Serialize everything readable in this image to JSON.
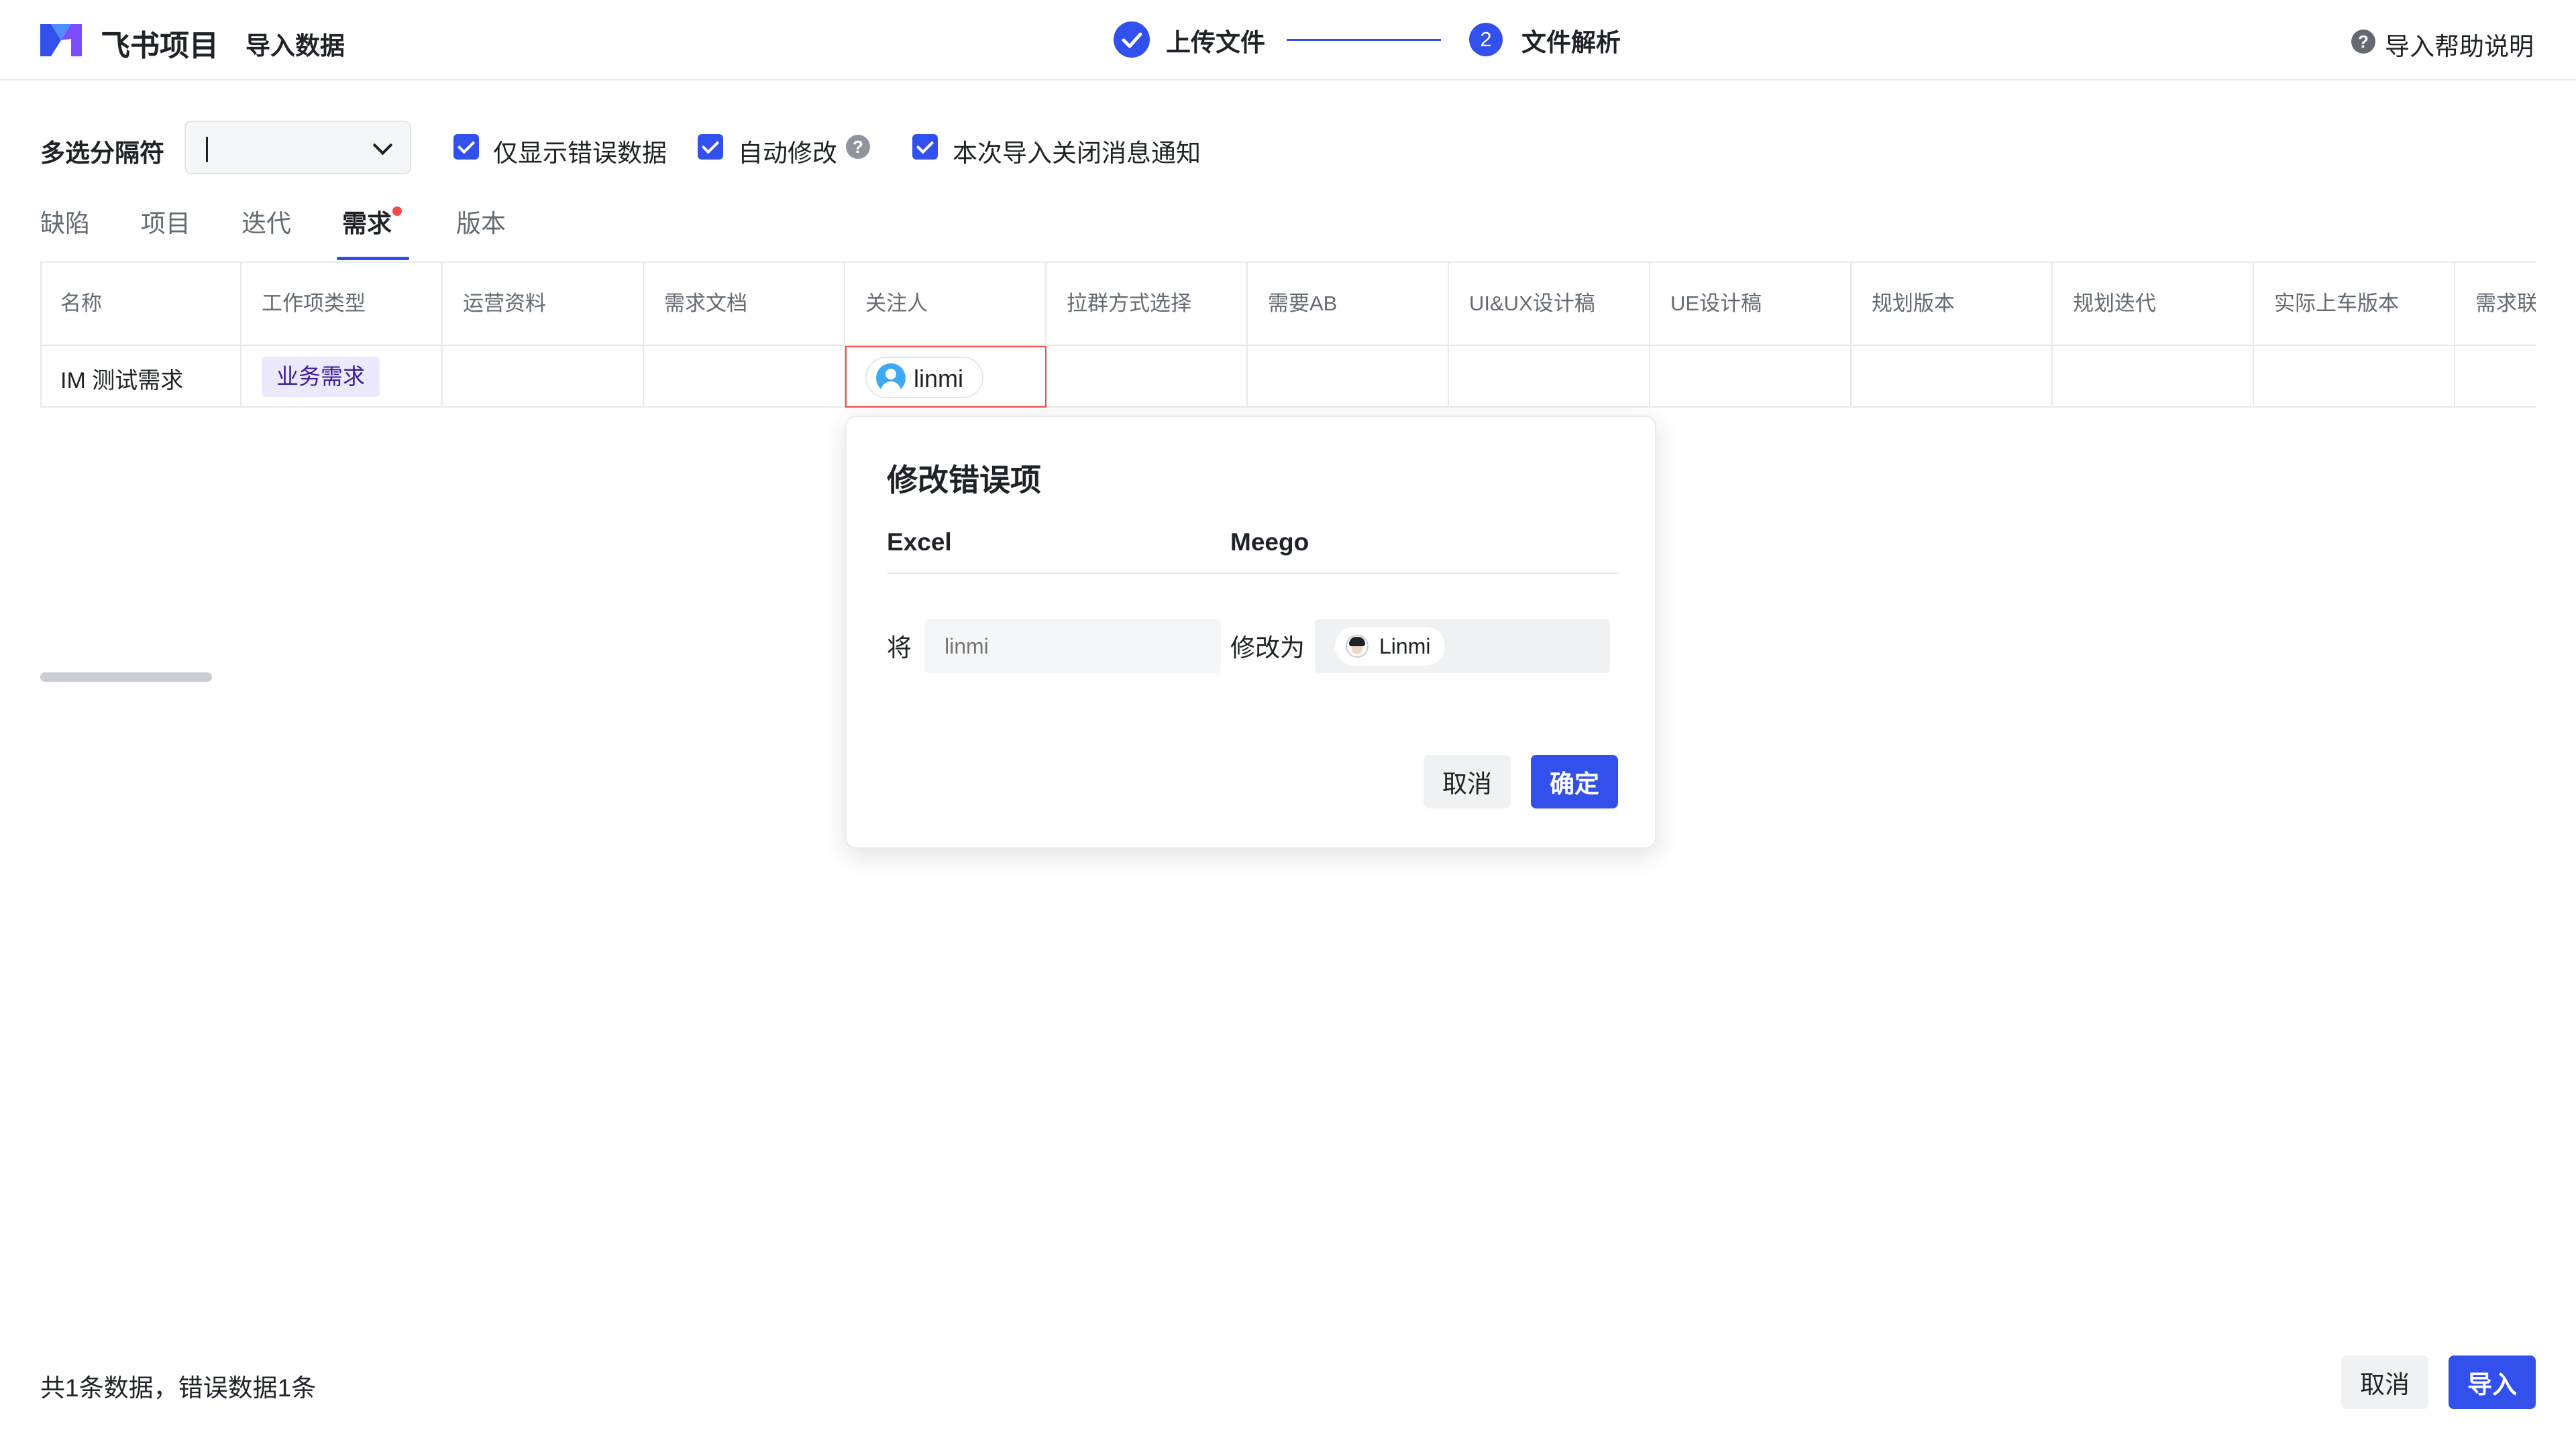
{
  "header": {
    "app_name": "飞书项目",
    "page_title": "导入数据",
    "steps": [
      {
        "label": "上传文件",
        "status": "completed",
        "icon": "check-icon"
      },
      {
        "number": "2",
        "label": "文件解析",
        "status": "current"
      }
    ],
    "help": {
      "icon": "question-circle-icon",
      "label": "导入帮助说明"
    }
  },
  "options": {
    "separator_label": "多选分隔符",
    "separator_value": "",
    "checkboxes": [
      {
        "label": "仅显示错误数据",
        "checked": true
      },
      {
        "label": "自动修改",
        "checked": true,
        "has_help_icon": true
      },
      {
        "label": "本次导入关闭消息通知",
        "checked": true
      }
    ],
    "help_icon_glyph": "?"
  },
  "tabs": [
    {
      "label": "缺陷",
      "active": false
    },
    {
      "label": "项目",
      "active": false
    },
    {
      "label": "迭代",
      "active": false
    },
    {
      "label": "需求",
      "active": true,
      "has_error": true
    },
    {
      "label": "版本",
      "active": false
    }
  ],
  "table": {
    "columns": [
      "名称",
      "工作项类型",
      "运营资料",
      "需求文档",
      "关注人",
      "拉群方式选择",
      "需要AB",
      "UI&UX设计稿",
      "UE设计稿",
      "规划版本",
      "规划迭代",
      "实际上车版本",
      "需求联"
    ],
    "rows": [
      {
        "name": "IM 测试需求",
        "type": "业务需求",
        "watcher": "linmi",
        "watcher_error": true,
        "cells": [
          "",
          "",
          "",
          "",
          "",
          "",
          "",
          "",
          "",
          "",
          ""
        ]
      }
    ]
  },
  "popover": {
    "title": "修改错误项",
    "col_source": "Excel",
    "col_target": "Meego",
    "from_label": "将",
    "from_placeholder": "linmi",
    "to_label": "修改为",
    "to_value": "Linmi",
    "cancel": "取消",
    "confirm": "确定"
  },
  "footer": {
    "summary": "共1条数据，错误数据1条",
    "cancel": "取消",
    "import": "导入"
  },
  "colors": {
    "primary": "#3250eb",
    "error": "#f54a45",
    "tag_bg": "#ede9fc",
    "tag_text": "#3b1c96"
  }
}
